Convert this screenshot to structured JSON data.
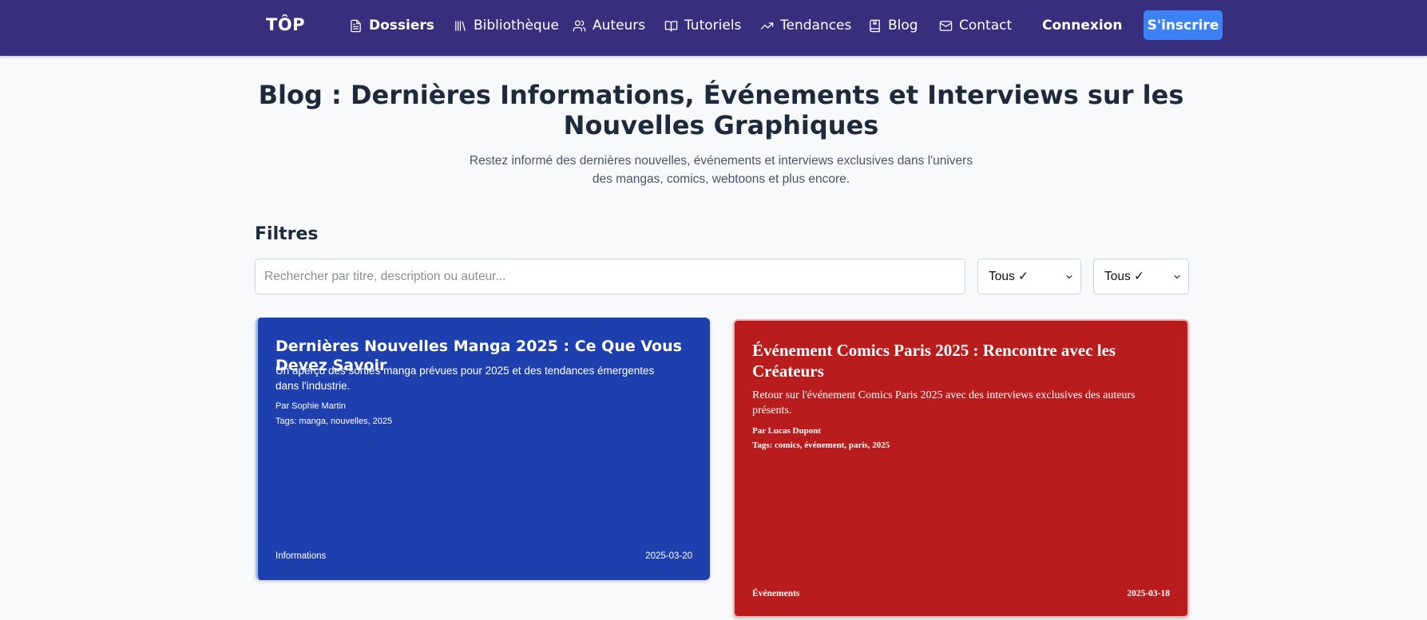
{
  "nav": {
    "brand": "TÔP",
    "items": [
      {
        "label": "Dossiers",
        "icon": "file-text-icon",
        "active": true
      },
      {
        "label": "Bibliothèque",
        "icon": "library-icon",
        "active": false
      },
      {
        "label": "Auteurs",
        "icon": "users-icon",
        "active": false
      },
      {
        "label": "Tutoriels",
        "icon": "book-open-icon",
        "active": false
      },
      {
        "label": "Tendances",
        "icon": "trending-up-icon",
        "active": false
      },
      {
        "label": "Blog",
        "icon": "book-icon",
        "active": false
      },
      {
        "label": "Contact",
        "icon": "mail-icon",
        "active": false
      }
    ],
    "login": "Connexion",
    "signup": "S'inscrire"
  },
  "header": {
    "title": "Blog : Dernières Informations, Événements et Interviews sur les Nouvelles Graphiques",
    "subtitle": "Restez informé des dernières nouvelles, événements et interviews exclusives dans l'univers des mangas, comics, webtoons et plus encore."
  },
  "filters": {
    "heading": "Filtres",
    "search_placeholder": "Rechercher par titre, description ou auteur...",
    "select_category": "Tous ✓",
    "select_tag": "Tous ✓"
  },
  "posts": [
    {
      "title": "Dernières Nouvelles Manga 2025 : Ce Que Vous Devez Savoir",
      "description": "Un aperçu des sorties manga prévues pour 2025 et des tendances émergentes dans l'industrie.",
      "author": "Par Sophie Martin",
      "tags": "Tags: manga, nouvelles, 2025",
      "category": "Informations",
      "date": "2025-03-20",
      "color": "#1e40af"
    },
    {
      "title": "Événement Comics Paris 2025 : Rencontre avec les Créateurs",
      "description": "Retour sur l'événement Comics Paris 2025 avec des interviews exclusives des auteurs présents.",
      "author": "Par Lucas Dupont",
      "tags": "Tags: comics, événement, paris, 2025",
      "category": "Événements",
      "date": "2025-03-18",
      "color": "#b91c1c"
    }
  ],
  "colors": {
    "navbar": "#372e7e",
    "accent": "#3b82f6",
    "background": "#f8f9fb"
  }
}
